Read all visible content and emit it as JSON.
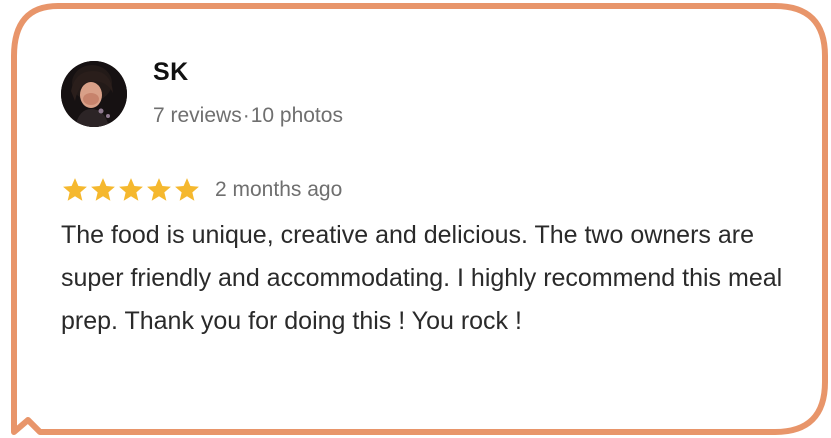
{
  "review": {
    "reviewer_name": "SK",
    "reviews_count": "7 reviews",
    "separator": "·",
    "photos_count": "10 photos",
    "rating": 5,
    "rating_max": 5,
    "time_ago": "2 months ago",
    "text": "The food is unique, creative and delicious. The two owners are super friendly and accommodating. I highly recommend this meal prep. Thank you for doing this ! You rock !"
  },
  "colors": {
    "bubble_border": "#e8956a",
    "star": "#f5b82e",
    "meta_text": "#6f6f6f",
    "body_text": "#2a2a2a"
  },
  "icons": {
    "avatar": "user-photo",
    "star": "star-icon"
  }
}
